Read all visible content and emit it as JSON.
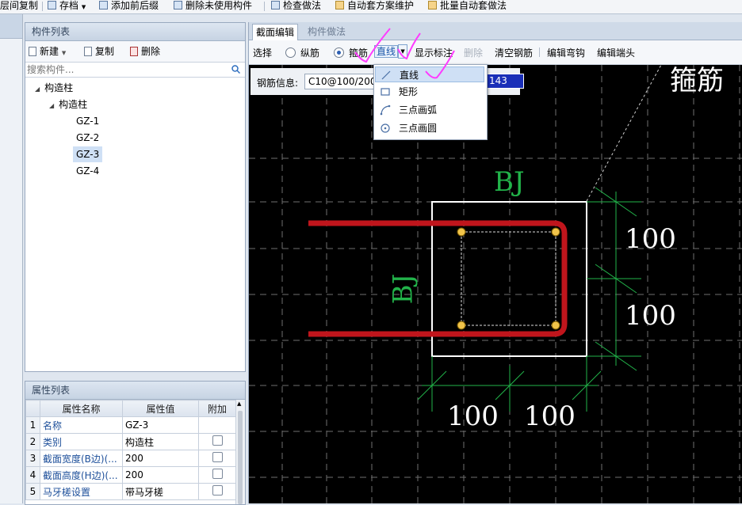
{
  "toolbar": {
    "items": [
      "层间复制",
      "存档",
      "添加前后缀",
      "删除未使用构件",
      "检查做法",
      "自动套方案维护",
      "批量自动套做法"
    ]
  },
  "component_list": {
    "title": "构件列表",
    "new_label": "新建",
    "copy_label": "复制",
    "delete_label": "删除",
    "search_placeholder": "搜索构件...",
    "tree": {
      "root": "构造柱",
      "child": "构造柱",
      "items": [
        "GZ-1",
        "GZ-2",
        "GZ-3",
        "GZ-4"
      ],
      "selected": "GZ-3"
    }
  },
  "property_list": {
    "title": "属性列表",
    "headers": [
      "属性名称",
      "属性值",
      "附加"
    ],
    "rows": [
      {
        "num": "1",
        "name": "名称",
        "value": "GZ-3",
        "has_check": false
      },
      {
        "num": "2",
        "name": "类别",
        "value": "构造柱",
        "has_check": true
      },
      {
        "num": "3",
        "name": "截面宽度(B边)(...",
        "value": "200",
        "has_check": true
      },
      {
        "num": "4",
        "name": "截面高度(H边)(...",
        "value": "200",
        "has_check": true
      },
      {
        "num": "5",
        "name": "马牙槎设置",
        "value": "带马牙槎",
        "has_check": true
      }
    ]
  },
  "editor": {
    "tabs": [
      "截面编辑",
      "构件做法"
    ],
    "active_tab": "截面编辑",
    "toolbar": {
      "select": "选择",
      "longitudinal": "纵筋",
      "stirrup": "箍筋",
      "shape_value": "直线",
      "show_annotation": "显示标注",
      "delete": "删除",
      "clear": "清空钢筋",
      "edit_hook": "编辑弯钩",
      "edit_end": "编辑端头"
    },
    "rebar_info_label": "钢筋信息:",
    "rebar_info_value": "C10@100/200",
    "selected_number": "143",
    "dropdown": [
      "直线",
      "矩形",
      "三点画弧",
      "三点画圆"
    ],
    "canvas": {
      "title": "箍筋",
      "label_top": "BJ",
      "label_left": "BJ",
      "dim_right_top": "100",
      "dim_right_bottom": "100",
      "dim_bottom_left": "100",
      "dim_bottom_right": "100"
    }
  },
  "colors": {
    "canvas_bg": "#000000",
    "rebar_red": "#c0151c",
    "dimension_green": "#22b34a",
    "annotation_magenta": "#ff3bff",
    "selection_blue": "#1a2fb8"
  }
}
